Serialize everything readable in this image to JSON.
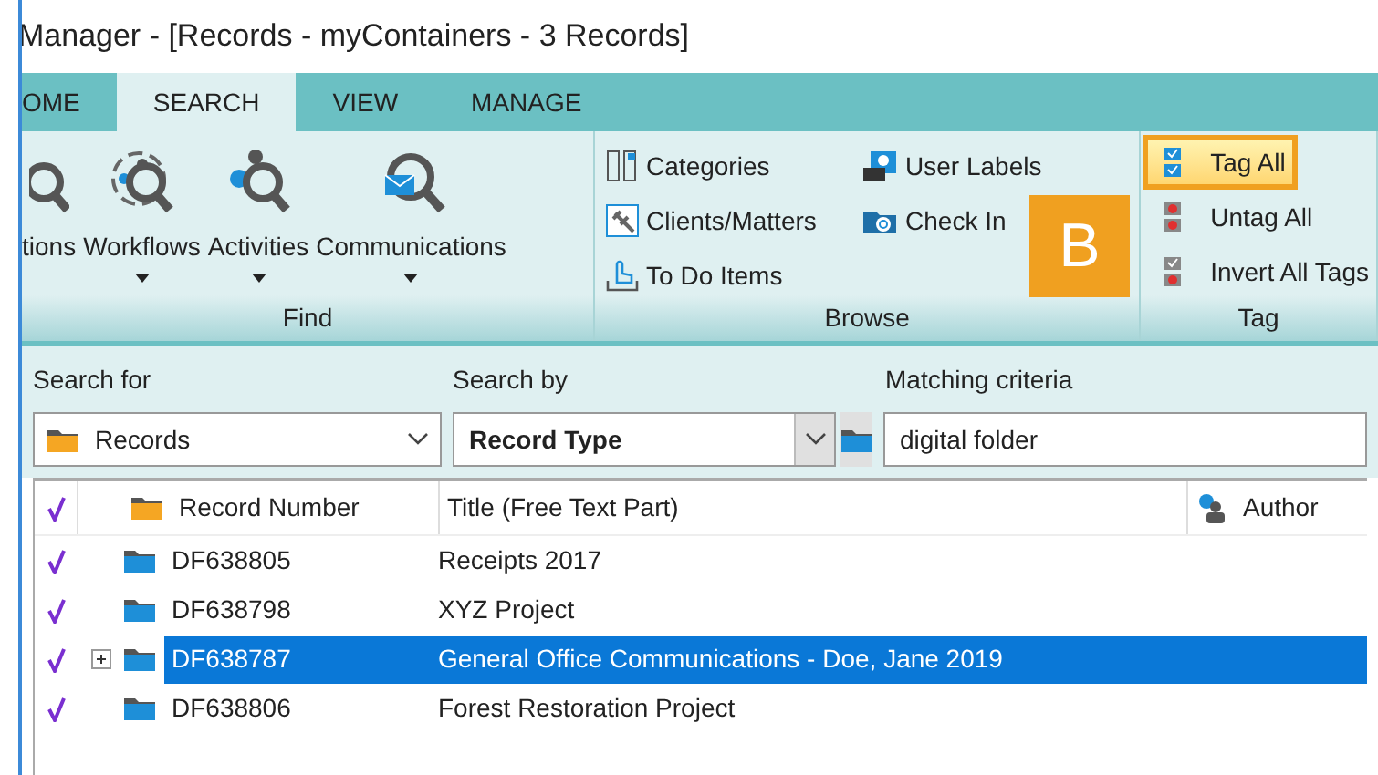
{
  "window": {
    "title": "Manager - [Records - myContainers - 3 Records]"
  },
  "tabs": [
    {
      "label": "OME",
      "selected": false
    },
    {
      "label": "SEARCH",
      "selected": true
    },
    {
      "label": "VIEW",
      "selected": false
    },
    {
      "label": "MANAGE",
      "selected": false
    }
  ],
  "ribbon": {
    "groups": [
      {
        "label": "Find",
        "kind": "large",
        "items": [
          {
            "label": "tions"
          },
          {
            "label": "Workflows"
          },
          {
            "label": "Activities"
          },
          {
            "label": "Communications"
          }
        ]
      },
      {
        "label": "Browse",
        "kind": "grid",
        "items": [
          {
            "label": "Categories"
          },
          {
            "label": "User Labels"
          },
          {
            "label": "Clients/Matters"
          },
          {
            "label": "Check In"
          },
          {
            "label": "To Do Items"
          }
        ]
      },
      {
        "label": "Tag",
        "kind": "list",
        "items": [
          {
            "label": "Tag All",
            "highlighted": true
          },
          {
            "label": "Untag All",
            "highlighted": false
          },
          {
            "label": "Invert All Tags",
            "highlighted": false
          }
        ]
      }
    ]
  },
  "callout": {
    "label": "B"
  },
  "search": {
    "search_for_label": "Search for",
    "search_for_value": "Records",
    "search_by_label": "Search by",
    "search_by_value": "Record Type",
    "matching_label": "Matching criteria",
    "matching_value": "digital folder"
  },
  "table": {
    "columns": [
      "Record Number",
      "Title (Free Text Part)",
      "Author"
    ],
    "rows": [
      {
        "tagged": true,
        "expandable": false,
        "selected": false,
        "number": "DF638805",
        "title": "Receipts 2017"
      },
      {
        "tagged": true,
        "expandable": false,
        "selected": false,
        "number": "DF638798",
        "title": "XYZ Project"
      },
      {
        "tagged": true,
        "expandable": true,
        "selected": true,
        "number": "DF638787",
        "title": "General Office Communications - Doe, Jane 2019"
      },
      {
        "tagged": true,
        "expandable": false,
        "selected": false,
        "number": "DF638806",
        "title": "Forest Restoration Project"
      }
    ]
  }
}
